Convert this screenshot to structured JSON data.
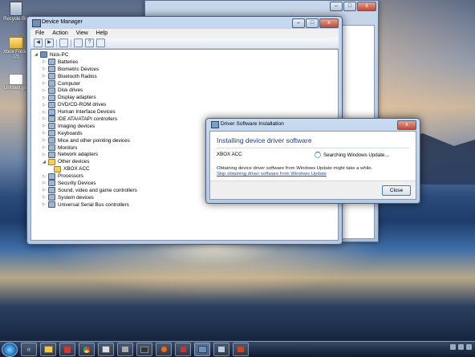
{
  "desktop": {
    "icons": [
      {
        "label": "Recycle Bin"
      },
      {
        "label": "Xbox Folder (2)"
      },
      {
        "label": "Untitled.jpg"
      }
    ]
  },
  "device_manager": {
    "title": "Device Manager",
    "menu": [
      "File",
      "Action",
      "View",
      "Help"
    ],
    "tree": {
      "root": "Nick-PC",
      "items": [
        "Batteries",
        "Biometric Devices",
        "Bluetooth Radios",
        "Computer",
        "Disk drives",
        "Display adapters",
        "DVD/CD-ROM drives",
        "Human Interface Devices",
        "IDE ATA/ATAPI controllers",
        "Imaging devices",
        "Keyboards",
        "Mice and other pointing devices",
        "Monitors",
        "Network adapters",
        "Other devices",
        "XBOX ACC",
        "Processors",
        "Security Devices",
        "Sound, video and game controllers",
        "System devices",
        "Universal Serial Bus controllers"
      ]
    }
  },
  "driver_dialog": {
    "title": "Driver Software Installation",
    "heading": "Installing device driver software",
    "device": "XBOX ACC",
    "status": "Searching Windows Update...",
    "note": "Obtaining device driver software from Windows Update might take a while.",
    "link": "Skip obtaining driver software from Windows Update",
    "close_label": "Close"
  },
  "window_controls": {
    "minimize": "–",
    "maximize": "□",
    "close": "x"
  }
}
